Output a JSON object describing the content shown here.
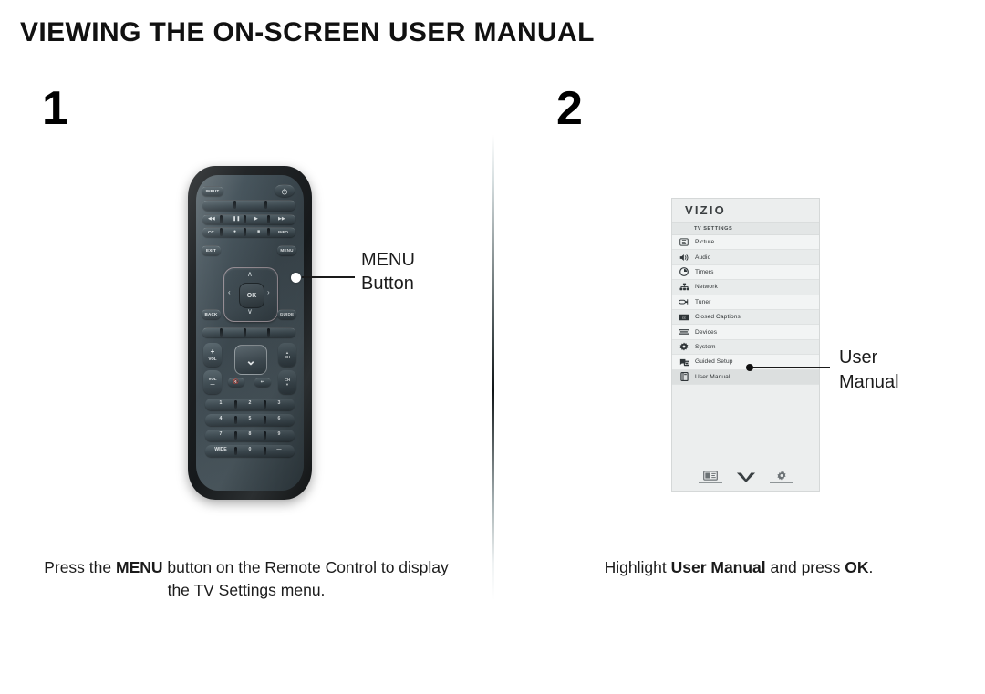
{
  "page": {
    "title": "VIEWING THE ON-SCREEN USER MANUAL",
    "background_color": "#ffffff",
    "text_color": "#1b1b1b"
  },
  "steps": [
    {
      "number": "1",
      "caption_prefix": "Press the ",
      "caption_bold": "MENU",
      "caption_suffix": " button on the Remote Control to display the TV Settings menu.",
      "callout_label_line1": "MENU",
      "callout_label_line2": "Button"
    },
    {
      "number": "2",
      "caption_prefix": "Highlight ",
      "caption_bold": "User Manual",
      "caption_mid": " and press ",
      "caption_bold2": "OK",
      "caption_suffix": ".",
      "callout_label_line1": "User",
      "callout_label_line2": "Manual"
    }
  ],
  "remote": {
    "input_button": "INPUT",
    "power_button": "power-icon",
    "transport_row1": [
      "rewind-icon",
      "pause-icon",
      "play-icon",
      "fast-forward-icon"
    ],
    "transport_row2": [
      "CC",
      "record-icon",
      "stop-icon",
      "INFO"
    ],
    "exit_button": "EXIT",
    "menu_button": "MENU",
    "back_button": "BACK",
    "guide_button": "GUIDE",
    "ok_button": "OK",
    "dpad": {
      "up": "∧",
      "down": "∨",
      "left": "‹",
      "right": "›"
    },
    "v_button": "⌄",
    "volume_up": {
      "symbol": "+",
      "label": "VOL"
    },
    "volume_down": {
      "symbol": "—",
      "label": "VOL"
    },
    "channel_up": {
      "symbol": "▲",
      "label": "CH"
    },
    "channel_down": {
      "symbol": "▼",
      "label": "CH"
    },
    "mute_button": "mute-icon",
    "last_button": "last-channel-icon",
    "keypad": [
      [
        "1",
        "2",
        "3"
      ],
      [
        "4",
        "5",
        "6"
      ],
      [
        "7",
        "8",
        "9"
      ],
      [
        "WIDE",
        "0",
        "—"
      ]
    ]
  },
  "tv_menu": {
    "brand": "VIZIO",
    "header": "TV SETTINGS",
    "items": [
      {
        "label": "Picture",
        "icon": "picture-icon"
      },
      {
        "label": "Audio",
        "icon": "audio-icon"
      },
      {
        "label": "Timers",
        "icon": "timers-icon"
      },
      {
        "label": "Network",
        "icon": "network-icon"
      },
      {
        "label": "Tuner",
        "icon": "tuner-icon"
      },
      {
        "label": "Closed Captions",
        "icon": "closed-captions-icon"
      },
      {
        "label": "Devices",
        "icon": "devices-icon"
      },
      {
        "label": "System",
        "icon": "system-icon"
      },
      {
        "label": "Guided Setup",
        "icon": "guided-setup-icon"
      },
      {
        "label": "User Manual",
        "icon": "user-manual-icon",
        "highlighted": true
      }
    ],
    "footer_icons": [
      "picture-mode-icon",
      "vizio-v-icon",
      "settings-gear-icon"
    ],
    "panel_color": "#eceeee",
    "row_color": "#f2f4f4",
    "highlight_color": "#dcdfdf"
  }
}
